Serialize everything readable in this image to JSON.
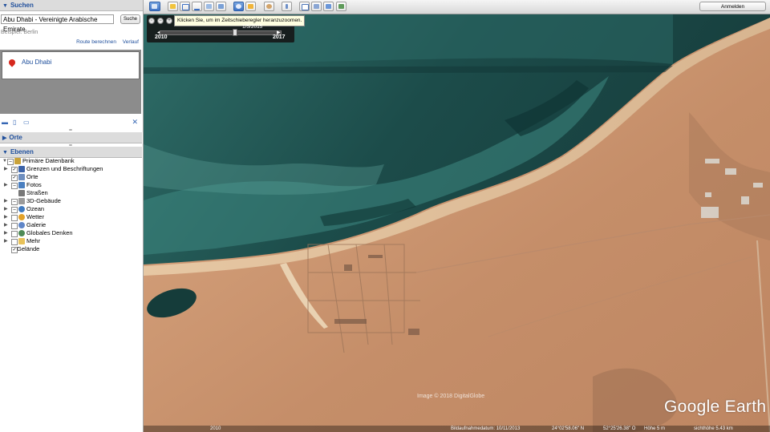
{
  "search": {
    "title": "Suchen",
    "query": "Abu Dhabi - Vereinigte Arabische Emirate",
    "button": "Suche",
    "example": "Beispiel: Berlin",
    "links": [
      "Route berechnen",
      "Verlauf"
    ],
    "result": "Abu Dhabi"
  },
  "places": {
    "title": "Orte"
  },
  "layers": {
    "title": "Ebenen",
    "items": [
      {
        "label": "Primäre Datenbank",
        "checked": "partial",
        "icon": "database-icon"
      },
      {
        "label": "Grenzen und Beschriftungen",
        "checked": "yes",
        "icon": "flag-icon"
      },
      {
        "label": "Orte",
        "checked": "yes",
        "icon": "place-icon"
      },
      {
        "label": "Fotos",
        "checked": "no",
        "icon": "photo-icon"
      },
      {
        "label": "Straßen",
        "checked": "none",
        "icon": "road-icon"
      },
      {
        "label": "3D-Gebäude",
        "checked": "no",
        "icon": "building-icon"
      },
      {
        "label": "Ozean",
        "checked": "no",
        "icon": "ocean-icon"
      },
      {
        "label": "Wetter",
        "checked": "no",
        "icon": "sun-icon"
      },
      {
        "label": "Galerie",
        "checked": "no",
        "icon": "gallery-icon"
      },
      {
        "label": "Globales Denken",
        "checked": "no",
        "icon": "globe-icon"
      },
      {
        "label": "Mehr",
        "checked": "no",
        "icon": "folder-icon"
      },
      {
        "label": "Gelände",
        "checked": "yes",
        "icon": "terrain-icon"
      }
    ]
  },
  "toolbar": {
    "login": "Anmelden"
  },
  "timeslider": {
    "tooltip": "Klicken Sie, um im Zeitschieberegler heranzuzoomen.",
    "date": "1/5/2015",
    "start": "2010",
    "end": "2017",
    "position": 0.64
  },
  "map": {
    "brand": "Google Earth",
    "copyright": "Image © 2018 DigitalGlobe",
    "status": {
      "year": "2010",
      "capture_date": "Bildaufnahmedatum: 10/11/2013",
      "lat": "24°02'58.06\" N",
      "lon": "52°25'26.38\" O",
      "elevation": "Höhe  5 m",
      "eye_alt": "sichthöhe  5.43 km"
    }
  },
  "colors": {
    "accent": "#1f4f9c",
    "pin": "#d6281d",
    "sea": "#1d4d4b",
    "sand": "#c99772"
  }
}
